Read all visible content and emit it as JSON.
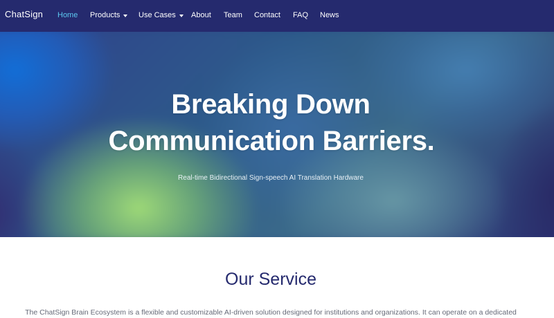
{
  "navbar": {
    "brand": "ChatSign",
    "items": [
      {
        "label": "Home",
        "active": true,
        "dropdown": false
      },
      {
        "label": "Products",
        "active": false,
        "dropdown": true
      },
      {
        "label": "Use Cases",
        "active": false,
        "dropdown": true
      },
      {
        "label": "About",
        "active": false,
        "dropdown": false
      },
      {
        "label": "Team",
        "active": false,
        "dropdown": false
      },
      {
        "label": "Contact",
        "active": false,
        "dropdown": false
      },
      {
        "label": "FAQ",
        "active": false,
        "dropdown": false
      },
      {
        "label": "News",
        "active": false,
        "dropdown": false
      }
    ]
  },
  "hero": {
    "title_line1": "Breaking Down",
    "title_line2": "Communication Barriers.",
    "subtitle": "Real-time Bidirectional Sign-speech AI Translation Hardware"
  },
  "service": {
    "title": "Our Service",
    "description": "The ChatSign Brain Ecosystem is a flexible and customizable AI-driven solution designed for institutions and organizations. It can operate on a dedicated"
  },
  "colors": {
    "navbar_bg": "#252a6e",
    "nav_active": "#5cc8f0",
    "heading": "#252a6e",
    "body_text": "#666a78"
  }
}
